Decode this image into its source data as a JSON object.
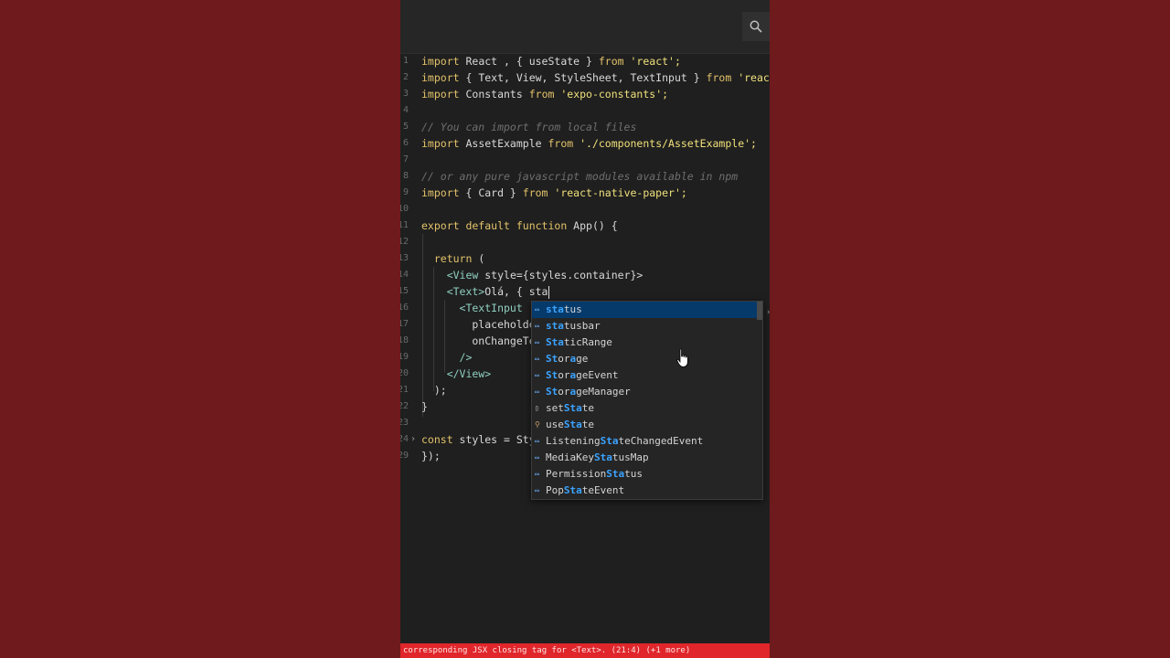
{
  "editor": {
    "lines": [
      {
        "n": "1",
        "segments": [
          {
            "t": "import ",
            "c": "kw"
          },
          {
            "t": "React , { useState } ",
            "c": "plain"
          },
          {
            "t": "from ",
            "c": "kw"
          },
          {
            "t": "'react';",
            "c": "str"
          }
        ]
      },
      {
        "n": "2",
        "segments": [
          {
            "t": "import ",
            "c": "kw"
          },
          {
            "t": "{ Text, View, StyleSheet, TextInput } ",
            "c": "plain"
          },
          {
            "t": "from ",
            "c": "kw"
          },
          {
            "t": "'react-native'",
            "c": "str"
          }
        ]
      },
      {
        "n": "3",
        "segments": [
          {
            "t": "import ",
            "c": "kw"
          },
          {
            "t": "Constants ",
            "c": "plain"
          },
          {
            "t": "from ",
            "c": "kw"
          },
          {
            "t": "'expo-constants';",
            "c": "str"
          }
        ]
      },
      {
        "n": "4",
        "segments": []
      },
      {
        "n": "5",
        "segments": [
          {
            "t": "// You can import from local files",
            "c": "cmt"
          }
        ]
      },
      {
        "n": "6",
        "segments": [
          {
            "t": "import ",
            "c": "kw"
          },
          {
            "t": "AssetExample ",
            "c": "plain"
          },
          {
            "t": "from ",
            "c": "kw"
          },
          {
            "t": "'./components/AssetExample';",
            "c": "str"
          }
        ]
      },
      {
        "n": "7",
        "segments": []
      },
      {
        "n": "8",
        "segments": [
          {
            "t": "// or any pure javascript modules available in npm",
            "c": "cmt"
          }
        ]
      },
      {
        "n": "9",
        "segments": [
          {
            "t": "import ",
            "c": "kw"
          },
          {
            "t": "{ Card } ",
            "c": "plain"
          },
          {
            "t": "from ",
            "c": "kw"
          },
          {
            "t": "'react-native-paper';",
            "c": "str"
          }
        ]
      },
      {
        "n": "10",
        "segments": []
      },
      {
        "n": "11",
        "segments": [
          {
            "t": "export default function ",
            "c": "kw"
          },
          {
            "t": "App() {",
            "c": "plain"
          }
        ]
      },
      {
        "n": "12",
        "segments": []
      },
      {
        "n": "13",
        "segments": [
          {
            "t": "  return ",
            "c": "kw"
          },
          {
            "t": "(",
            "c": "plain"
          }
        ]
      },
      {
        "n": "14",
        "segments": [
          {
            "t": "    <View ",
            "c": "tag"
          },
          {
            "t": "style={styles.container}>",
            "c": "plain"
          }
        ]
      },
      {
        "n": "15",
        "segments": [
          {
            "t": "    <Text>",
            "c": "tag"
          },
          {
            "t": "Olá, { sta",
            "c": "plain"
          }
        ],
        "cursor": true
      },
      {
        "n": "16",
        "segments": [
          {
            "t": "      <TextInput",
            "c": "tag"
          }
        ]
      },
      {
        "n": "17",
        "segments": [
          {
            "t": "        placeholder=",
            "c": "plain"
          }
        ]
      },
      {
        "n": "18",
        "segments": [
          {
            "t": "        onChangeText",
            "c": "plain"
          }
        ]
      },
      {
        "n": "19",
        "segments": [
          {
            "t": "      />",
            "c": "tag"
          }
        ]
      },
      {
        "n": "20",
        "segments": [
          {
            "t": "    </View>",
            "c": "tag"
          }
        ]
      },
      {
        "n": "21",
        "segments": [
          {
            "t": "  );",
            "c": "plain"
          }
        ]
      },
      {
        "n": "22",
        "segments": [
          {
            "t": "}",
            "c": "plain"
          }
        ]
      },
      {
        "n": "23",
        "segments": []
      },
      {
        "n": "24",
        "segments": [
          {
            "t": "const ",
            "c": "kw"
          },
          {
            "t": "styles = Style",
            "c": "plain"
          }
        ],
        "fold": true
      },
      {
        "n": "29",
        "segments": [
          {
            "t": "});",
            "c": "plain"
          }
        ]
      }
    ]
  },
  "suggestions": {
    "items": [
      {
        "pre": "",
        "match": "sta",
        "post": "tus",
        "kind": "kw"
      },
      {
        "pre": "",
        "match": "sta",
        "post": "tusbar",
        "kind": "kw"
      },
      {
        "pre": "",
        "match": "Sta",
        "post": "ticRange",
        "kind": "kw"
      },
      {
        "pre": "",
        "match": "St",
        "post": "or",
        "match2": "a",
        "post2": "ge",
        "kind": "kw"
      },
      {
        "pre": "",
        "match": "St",
        "post": "or",
        "match2": "a",
        "post2": "geEvent",
        "kind": "kw"
      },
      {
        "pre": "",
        "match": "St",
        "post": "or",
        "match2": "a",
        "post2": "geManager",
        "kind": "kw"
      },
      {
        "pre": "set",
        "match": "Sta",
        "post": "te",
        "kind": "file"
      },
      {
        "pre": "use",
        "match": "Sta",
        "post": "te",
        "kind": "var"
      },
      {
        "pre": "Listening",
        "match": "Sta",
        "post": "teChangedEvent",
        "kind": "kw"
      },
      {
        "pre": "MediaKey",
        "match": "Sta",
        "post": "tusMap",
        "kind": "kw"
      },
      {
        "pre": "Permission",
        "match": "Sta",
        "post": "tus",
        "kind": "kw"
      },
      {
        "pre": "Pop",
        "match": "Sta",
        "post": "teEvent",
        "kind": "kw"
      }
    ]
  },
  "statusbar": {
    "text": "corresponding JSX closing tag for <Text>. (21:4) (+1 more)"
  },
  "icons": {
    "search": "search-icon",
    "pointer": "hand-pointer-icon"
  },
  "colors": {
    "background": "#6f1a1d",
    "editor_bg": "#1f1f1f",
    "keyword": "#e3c36a",
    "string": "#f0e07b",
    "match_highlight": "#3ba4ff",
    "selected_item": "#063a6b",
    "status_error": "#e0262b"
  }
}
